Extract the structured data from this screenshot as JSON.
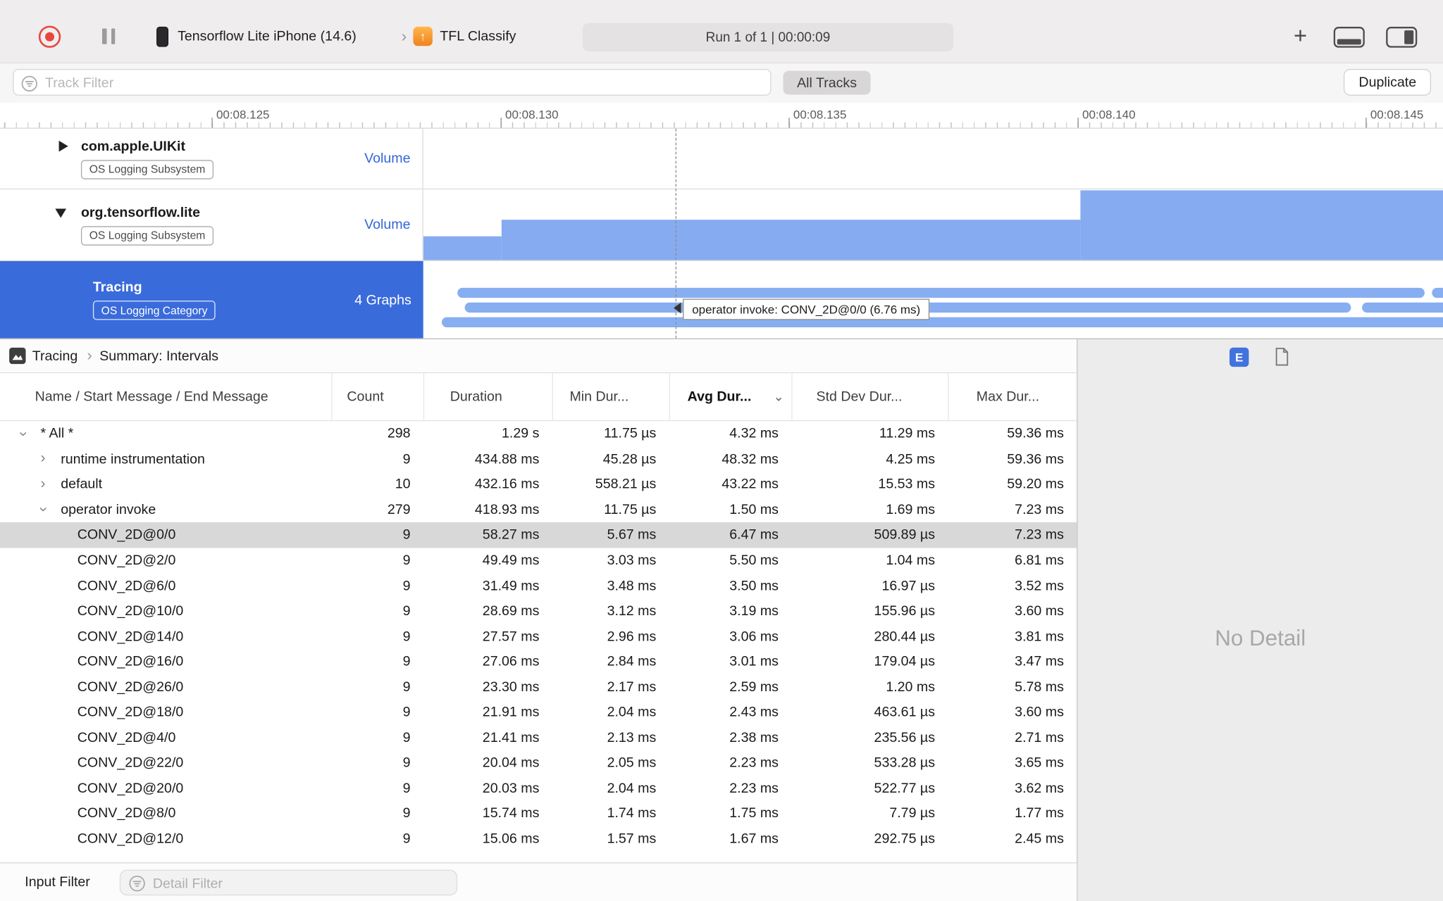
{
  "toolbar": {
    "device": "Tensorflow Lite iPhone (14.6)",
    "target": "TFL Classify",
    "run_status": "Run 1 of 1   |   00:00:09"
  },
  "filter_bar": {
    "track_filter_placeholder": "Track Filter",
    "all_tracks_label": "All Tracks",
    "duplicate_label": "Duplicate"
  },
  "ruler": {
    "ticks": [
      "00:08.125",
      "00:08.130",
      "00:08.135",
      "00:08.140",
      "00:08.145"
    ]
  },
  "tracks": [
    {
      "name": "com.apple.UIKit",
      "badge": "OS Logging Subsystem",
      "meta": "Volume"
    },
    {
      "name": "org.tensorflow.lite",
      "badge": "OS Logging Subsystem",
      "meta": "Volume"
    },
    {
      "name": "Tracing",
      "badge": "OS Logging Category",
      "meta": "4 Graphs"
    }
  ],
  "tooltip": "operator invoke: CONV_2D@0/0 (6.76 ms)",
  "detail_header": {
    "breadcrumb_root": "Tracing",
    "breadcrumb_leaf": "Summary: Intervals",
    "e_badge": "E"
  },
  "table": {
    "columns": {
      "name": "Name / Start Message / End Message",
      "count": "Count",
      "duration": "Duration",
      "min": "Min Dur...",
      "avg": "Avg Dur...",
      "std": "Std Dev Dur...",
      "max": "Max Dur..."
    },
    "rows": [
      {
        "name": "* All *",
        "indent": 0,
        "chevron": "down",
        "count": "298",
        "duration": "1.29 s",
        "min": "11.75 µs",
        "avg": "4.32 ms",
        "std": "11.29 ms",
        "max": "59.36 ms"
      },
      {
        "name": "runtime instrumentation",
        "indent": 1,
        "chevron": "right",
        "count": "9",
        "duration": "434.88 ms",
        "min": "45.28 µs",
        "avg": "48.32 ms",
        "std": "4.25 ms",
        "max": "59.36 ms"
      },
      {
        "name": "default",
        "indent": 1,
        "chevron": "right",
        "count": "10",
        "duration": "432.16 ms",
        "min": "558.21 µs",
        "avg": "43.22 ms",
        "std": "15.53 ms",
        "max": "59.20 ms"
      },
      {
        "name": "operator invoke",
        "indent": 1,
        "chevron": "down",
        "count": "279",
        "duration": "418.93 ms",
        "min": "11.75 µs",
        "avg": "1.50 ms",
        "std": "1.69 ms",
        "max": "7.23 ms"
      },
      {
        "name": "CONV_2D@0/0",
        "indent": 2,
        "selected": true,
        "count": "9",
        "duration": "58.27 ms",
        "min": "5.67 ms",
        "avg": "6.47 ms",
        "std": "509.89 µs",
        "max": "7.23 ms"
      },
      {
        "name": "CONV_2D@2/0",
        "indent": 2,
        "count": "9",
        "duration": "49.49 ms",
        "min": "3.03 ms",
        "avg": "5.50 ms",
        "std": "1.04 ms",
        "max": "6.81 ms"
      },
      {
        "name": "CONV_2D@6/0",
        "indent": 2,
        "count": "9",
        "duration": "31.49 ms",
        "min": "3.48 ms",
        "avg": "3.50 ms",
        "std": "16.97 µs",
        "max": "3.52 ms"
      },
      {
        "name": "CONV_2D@10/0",
        "indent": 2,
        "count": "9",
        "duration": "28.69 ms",
        "min": "3.12 ms",
        "avg": "3.19 ms",
        "std": "155.96 µs",
        "max": "3.60 ms"
      },
      {
        "name": "CONV_2D@14/0",
        "indent": 2,
        "count": "9",
        "duration": "27.57 ms",
        "min": "2.96 ms",
        "avg": "3.06 ms",
        "std": "280.44 µs",
        "max": "3.81 ms"
      },
      {
        "name": "CONV_2D@16/0",
        "indent": 2,
        "count": "9",
        "duration": "27.06 ms",
        "min": "2.84 ms",
        "avg": "3.01 ms",
        "std": "179.04 µs",
        "max": "3.47 ms"
      },
      {
        "name": "CONV_2D@26/0",
        "indent": 2,
        "count": "9",
        "duration": "23.30 ms",
        "min": "2.17 ms",
        "avg": "2.59 ms",
        "std": "1.20 ms",
        "max": "5.78 ms"
      },
      {
        "name": "CONV_2D@18/0",
        "indent": 2,
        "count": "9",
        "duration": "21.91 ms",
        "min": "2.04 ms",
        "avg": "2.43 ms",
        "std": "463.61 µs",
        "max": "3.60 ms"
      },
      {
        "name": "CONV_2D@4/0",
        "indent": 2,
        "count": "9",
        "duration": "21.41 ms",
        "min": "2.13 ms",
        "avg": "2.38 ms",
        "std": "235.56 µs",
        "max": "2.71 ms"
      },
      {
        "name": "CONV_2D@22/0",
        "indent": 2,
        "count": "9",
        "duration": "20.04 ms",
        "min": "2.05 ms",
        "avg": "2.23 ms",
        "std": "533.28 µs",
        "max": "3.65 ms"
      },
      {
        "name": "CONV_2D@20/0",
        "indent": 2,
        "count": "9",
        "duration": "20.03 ms",
        "min": "2.04 ms",
        "avg": "2.23 ms",
        "std": "522.77 µs",
        "max": "3.62 ms"
      },
      {
        "name": "CONV_2D@8/0",
        "indent": 2,
        "count": "9",
        "duration": "15.74 ms",
        "min": "1.74 ms",
        "avg": "1.75 ms",
        "std": "7.79 µs",
        "max": "1.77 ms"
      },
      {
        "name": "CONV_2D@12/0",
        "indent": 2,
        "count": "9",
        "duration": "15.06 ms",
        "min": "1.57 ms",
        "avg": "1.67 ms",
        "std": "292.75 µs",
        "max": "2.45 ms"
      }
    ]
  },
  "detail_panel": {
    "empty_text": "No Detail"
  },
  "bottom_bar": {
    "label": "Input Filter",
    "detail_filter_placeholder": "Detail Filter"
  },
  "icons": {
    "plus": "+",
    "breadcrumb_chevron": "›",
    "sort_chevron": "⌄",
    "arrow_up": "↑",
    "row_chevron": "›"
  },
  "colors": {
    "accent_blue": "#3a6bdb",
    "bar_blue": "#86abf0",
    "record_red": "#e8473f",
    "selected_row_gray": "#d8d8d8"
  }
}
